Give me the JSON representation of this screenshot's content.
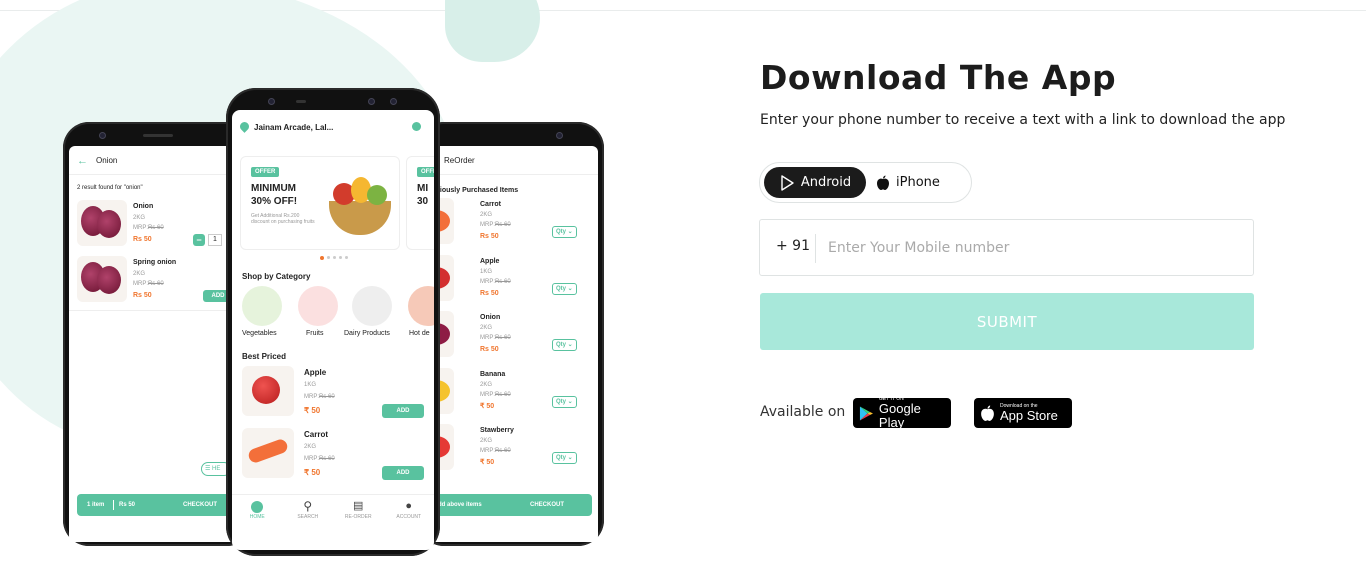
{
  "download": {
    "title": "Download The App",
    "subtitle": "Enter your phone number to receive a text with a link to download the app",
    "toggle": {
      "android_label": "Android",
      "iphone_label": "iPhone",
      "selected": "Android"
    },
    "country_code": "+ 91",
    "mobile_placeholder": "Enter Your Mobile number",
    "submit_label": "SUBMIT",
    "available_on": "Available on",
    "google_play": {
      "small": "GET IT ON",
      "big": "Google Play"
    },
    "app_store": {
      "small": "Download on the",
      "big": "App Store"
    }
  },
  "left_phone": {
    "search_value": "Onion",
    "result_text": "2 result found for \"onion\"",
    "products": [
      {
        "name": "Onion",
        "weight": "2KG",
        "mrp_label": "MRP:",
        "mrp": "Rs 60",
        "price": "Rs 50",
        "qty": "1"
      },
      {
        "name": "Spring onion",
        "weight": "2KG",
        "mrp_label": "MRP:",
        "mrp": "Rs 60",
        "price": "Rs 50",
        "action": "ADD"
      }
    ],
    "cart_bar": {
      "items": "1 item",
      "total": "Rs 50",
      "checkout": "CHECKOUT"
    }
  },
  "center_phone": {
    "location": "Jainam Arcade, Lal...",
    "banner": {
      "badge": "OFFER",
      "headline_1": "MINIMUM",
      "headline_2": "30% OFF!",
      "note": "Get Additional Rs.200 discount on purchasing fruits"
    },
    "banner2": {
      "badge": "OFFER",
      "headline_1": "MI",
      "headline_2": "30"
    },
    "category_heading": "Shop by Category",
    "categories": [
      "Vegetables",
      "Fruits",
      "Dairy Products",
      "Hot de"
    ],
    "best_heading": "Best Priced",
    "products": [
      {
        "name": "Apple",
        "weight": "1KG",
        "mrp_label": "MRP:",
        "mrp": "Rs 60",
        "price": "₹ 50",
        "action": "ADD"
      },
      {
        "name": "Carrot",
        "weight": "2KG",
        "mrp_label": "MRP:",
        "mrp": "Rs 60",
        "price": "₹ 50",
        "action": "ADD"
      }
    ],
    "nav": [
      "HOME",
      "SEARCH",
      "RE-ORDER",
      "ACCOUNT"
    ]
  },
  "right_phone": {
    "title": "ReOrder",
    "section": "viously Purchased Items",
    "products": [
      {
        "name": "Carrot",
        "weight": "2KG",
        "mrp": "Rs 60",
        "price": "Rs 50"
      },
      {
        "name": "Apple",
        "weight": "1KG",
        "mrp": "Rs 60",
        "price": "Rs 50"
      },
      {
        "name": "Onion",
        "weight": "2KG",
        "mrp": "Rs 60",
        "price": "Rs 50"
      },
      {
        "name": "Banana",
        "weight": "2KG",
        "mrp": "Rs 60",
        "price": "₹ 50"
      },
      {
        "name": "Stawberry",
        "weight": "2KG",
        "mrp": "Rs 60",
        "price": "₹ 50"
      }
    ],
    "mrp_label": "MRP:",
    "qty_label": "Qty",
    "bottom_bar": {
      "text": "dd above items",
      "checkout": "CHECKOUT"
    }
  },
  "colors": {
    "accent": "#59c29f",
    "submit_bg": "#a8e8da",
    "price": "#f0762f",
    "blob": "#eaf6f3"
  }
}
